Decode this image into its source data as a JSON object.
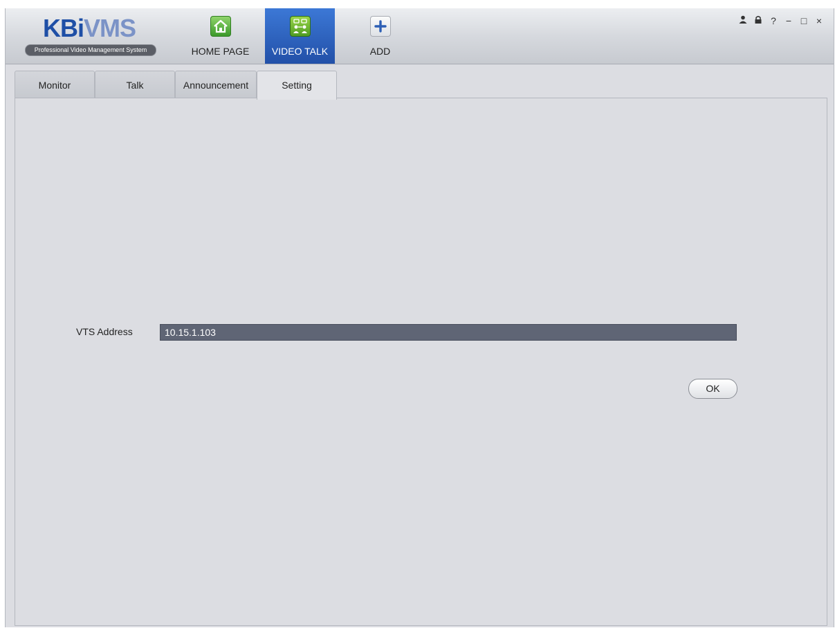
{
  "app": {
    "logo": {
      "name_part1": "KB",
      "name_part2": "i",
      "name_part3": "VMS",
      "subtitle": "Professional Video Management System"
    }
  },
  "nav": {
    "items": [
      {
        "label": "HOME PAGE",
        "icon": "home-icon",
        "active": false
      },
      {
        "label": "VIDEO TALK",
        "icon": "video-talk-icon",
        "active": true
      },
      {
        "label": "ADD",
        "icon": "plus-icon",
        "active": false
      }
    ]
  },
  "window_controls": {
    "user": "user-icon",
    "lock": "lock-icon",
    "help": "?",
    "minimize": "−",
    "maximize": "□",
    "close": "×"
  },
  "tabs": [
    {
      "label": "Monitor",
      "active": false
    },
    {
      "label": "Talk",
      "active": false
    },
    {
      "label": "Announcement",
      "active": false
    },
    {
      "label": "Setting",
      "active": true
    }
  ],
  "setting": {
    "vts_label": "VTS Address",
    "vts_value": "10.15.1.103",
    "ok_label": "OK"
  },
  "colors": {
    "active_nav": "#2f62bf",
    "input_bg": "#5f6575",
    "panel_bg": "#dcdde2"
  }
}
